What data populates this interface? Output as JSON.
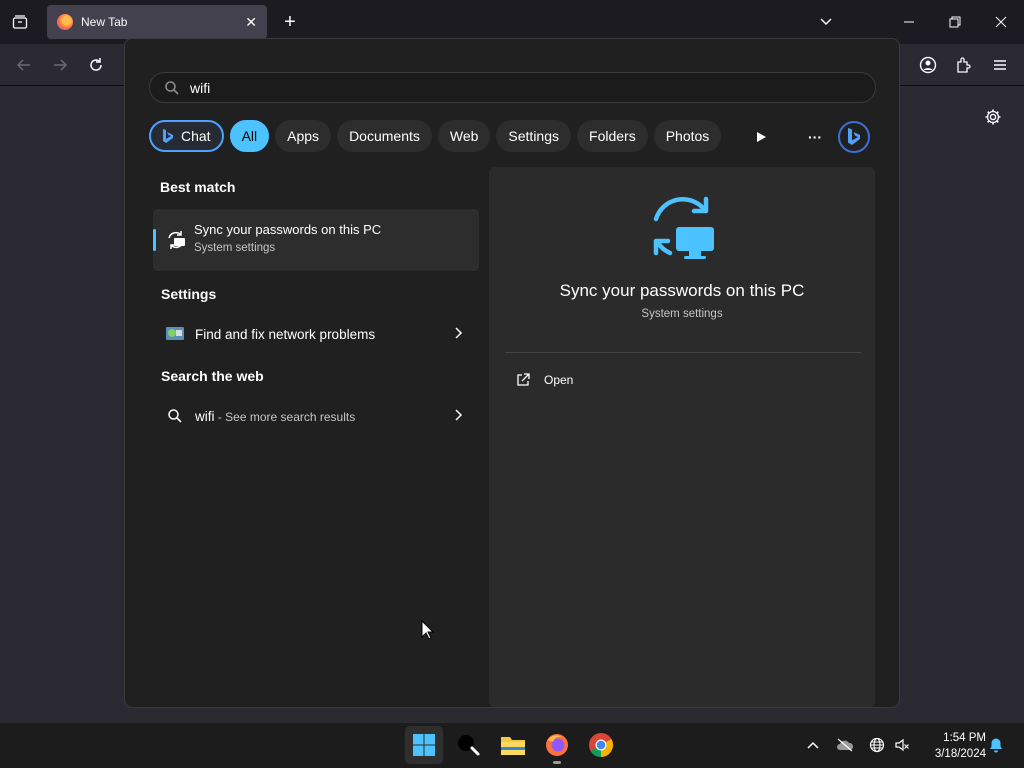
{
  "browser": {
    "tab_title": "New Tab",
    "tab_close": "✕",
    "new_tab": "+"
  },
  "search": {
    "query": "wifi",
    "filters": [
      {
        "label": "Chat"
      },
      {
        "label": "All"
      },
      {
        "label": "Apps"
      },
      {
        "label": "Documents"
      },
      {
        "label": "Web"
      },
      {
        "label": "Settings"
      },
      {
        "label": "Folders"
      },
      {
        "label": "Photos"
      }
    ],
    "more": "···"
  },
  "results": {
    "best_match_heading": "Best match",
    "best_match": {
      "title": "Sync your passwords on this PC",
      "subtitle": "System settings"
    },
    "settings_heading": "Settings",
    "settings_item": "Find and fix network problems",
    "web_heading": "Search the web",
    "web_item": {
      "query": "wifi",
      "suffix": " - See more search results"
    }
  },
  "preview": {
    "title": "Sync your passwords on this PC",
    "subtitle": "System settings",
    "open_label": "Open"
  },
  "taskbar": {
    "time": "1:54 PM",
    "date": "3/18/2024"
  },
  "colors": {
    "accent": "#4cc2ff",
    "panel": "#202020",
    "preview": "#2b2b2b"
  }
}
